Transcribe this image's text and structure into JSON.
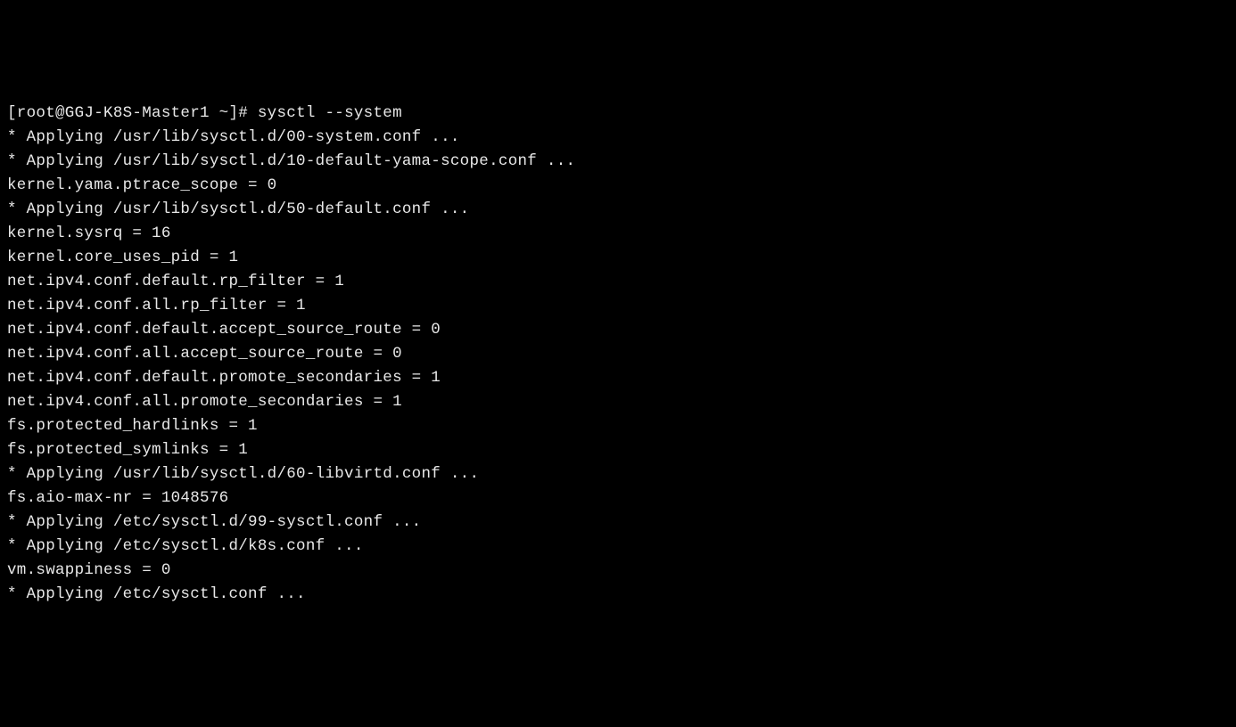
{
  "prompt": "[root@GGJ-K8S-Master1 ~]# ",
  "command": "sysctl --system",
  "lines": [
    "* Applying /usr/lib/sysctl.d/00-system.conf ...",
    "* Applying /usr/lib/sysctl.d/10-default-yama-scope.conf ...",
    "kernel.yama.ptrace_scope = 0",
    "* Applying /usr/lib/sysctl.d/50-default.conf ...",
    "kernel.sysrq = 16",
    "kernel.core_uses_pid = 1",
    "net.ipv4.conf.default.rp_filter = 1",
    "net.ipv4.conf.all.rp_filter = 1",
    "net.ipv4.conf.default.accept_source_route = 0",
    "net.ipv4.conf.all.accept_source_route = 0",
    "net.ipv4.conf.default.promote_secondaries = 1",
    "net.ipv4.conf.all.promote_secondaries = 1",
    "fs.protected_hardlinks = 1",
    "fs.protected_symlinks = 1",
    "* Applying /usr/lib/sysctl.d/60-libvirtd.conf ...",
    "fs.aio-max-nr = 1048576",
    "* Applying /etc/sysctl.d/99-sysctl.conf ...",
    "* Applying /etc/sysctl.d/k8s.conf ...",
    "vm.swappiness = 0",
    "* Applying /etc/sysctl.conf ..."
  ]
}
